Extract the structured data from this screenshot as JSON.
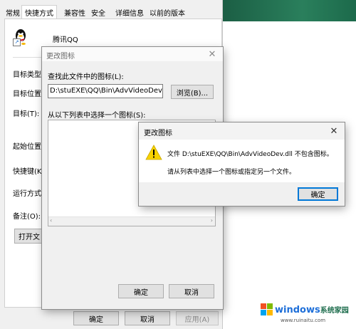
{
  "background_window": {
    "tabs": [
      {
        "label": "常规"
      },
      {
        "label": "快捷方式"
      },
      {
        "label": "兼容性"
      },
      {
        "label": "安全"
      },
      {
        "label": "详细信息"
      },
      {
        "label": "以前的版本"
      }
    ],
    "app_name": "腾讯QQ",
    "field_labels": {
      "target_type": "目标类型:",
      "target_location": "目标位置:",
      "target": "目标(T):",
      "start_in": "起始位置(S",
      "shortcut_key": "快捷键(K):",
      "run": "运行方式(R",
      "comment": "备注(O):"
    },
    "open_file_location_label": "打开文",
    "ok_label": "确定",
    "cancel_label": "取消",
    "apply_label": "应用(A)"
  },
  "change_icon_dialog": {
    "title": "更改图标",
    "search_label": "查找此文件中的图标(L):",
    "file_path": "D:\\stuEXE\\QQ\\Bin\\AdvVideoDev.dll",
    "browse_label": "浏览(B)...",
    "select_label": "从以下列表中选择一个图标(S):",
    "ok_label": "确定",
    "cancel_label": "取消"
  },
  "error_dialog": {
    "title": "更改图标",
    "message_line1": "文件 D:\\stuEXE\\QQ\\Bin\\AdvVideoDev.dll 不包含图标。",
    "message_line2": "请从列表中选择一个图标或指定另一个文件。",
    "ok_label": "确定"
  },
  "watermark": {
    "brand": "windows",
    "suffix": "系统家园",
    "url": "www.ruinaitu.com"
  },
  "colors": {
    "desktop_green": "#1f6e4e",
    "accent_blue": "#0078d7",
    "warning_yellow": "#f8d200"
  }
}
